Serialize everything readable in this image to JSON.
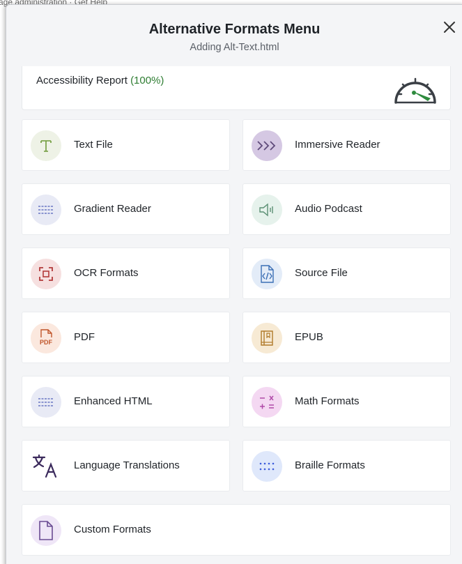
{
  "background": {
    "snippet": "age administration · Get Help"
  },
  "modal": {
    "title": "Alternative Formats Menu",
    "subtitle": "Adding Alt-Text.html"
  },
  "report": {
    "label": "Accessibility Report",
    "percent": "(100%)"
  },
  "formats": [
    {
      "label": "Text File",
      "icon": "text-t-icon"
    },
    {
      "label": "Immersive Reader",
      "icon": "chevrons-right-icon"
    },
    {
      "label": "Gradient Reader",
      "icon": "gradient-lines-icon"
    },
    {
      "label": "Audio Podcast",
      "icon": "speaker-icon"
    },
    {
      "label": "OCR Formats",
      "icon": "scan-frame-icon"
    },
    {
      "label": "Source File",
      "icon": "code-file-icon"
    },
    {
      "label": "PDF",
      "icon": "pdf-file-icon",
      "icon_text": "PDF"
    },
    {
      "label": "EPUB",
      "icon": "book-icon"
    },
    {
      "label": "Enhanced HTML",
      "icon": "lines-icon"
    },
    {
      "label": "Math Formats",
      "icon": "math-symbols-icon",
      "icon_text": "− × + ="
    },
    {
      "label": "Language Translations",
      "icon": "translate-icon"
    },
    {
      "label": "Braille Formats",
      "icon": "braille-dots-icon"
    },
    {
      "label": "Custom Formats",
      "icon": "blank-file-icon"
    }
  ],
  "colors": {
    "green": "#2e7d32",
    "purple": "#6a4c93",
    "orange": "#c0562b",
    "red": "#b23a3a",
    "blue": "#3b5bdb"
  }
}
